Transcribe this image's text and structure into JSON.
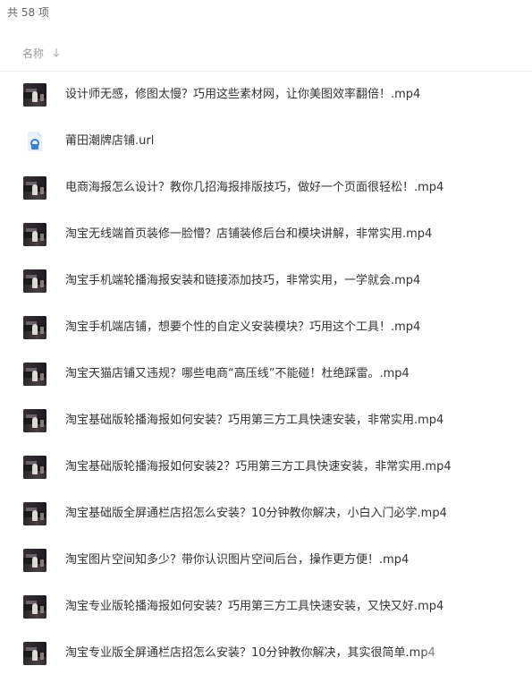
{
  "summary": {
    "count_text": "共 58 项"
  },
  "header": {
    "name_label": "名称"
  },
  "files": [
    {
      "name": "设计师无感，修图太慢？巧用这些素材网，让你美图效率翻倍！.mp4",
      "icon": "video-thumbnail-icon"
    },
    {
      "name": "莆田潮牌店铺.url",
      "icon": "link-file-icon"
    },
    {
      "name": "电商海报怎么设计？教你几招海报排版技巧，做好一个页面很轻松！.mp4",
      "icon": "video-thumbnail-icon"
    },
    {
      "name": "淘宝无线端首页装修一脸懵？店铺装修后台和模块讲解，非常实用.mp4",
      "icon": "video-thumbnail-icon"
    },
    {
      "name": "淘宝手机端轮播海报安装和链接添加技巧，非常实用，一学就会.mp4",
      "icon": "video-thumbnail-icon"
    },
    {
      "name": "淘宝手机端店铺，想要个性的自定义安装模块？巧用这个工具！.mp4",
      "icon": "video-thumbnail-icon"
    },
    {
      "name": "淘宝天猫店铺又违规？哪些电商“高压线”不能碰！杜绝踩雷。.mp4",
      "icon": "video-thumbnail-icon"
    },
    {
      "name": "淘宝基础版轮播海报如何安装？巧用第三方工具快速安装，非常实用.mp4",
      "icon": "video-thumbnail-icon"
    },
    {
      "name": "淘宝基础版轮播海报如何安装2？巧用第三方工具快速安装，非常实用.mp4",
      "icon": "video-thumbnail-icon"
    },
    {
      "name": "淘宝基础版全屏通栏店招怎么安装？10分钟教你解决，小白入门必学.mp4",
      "icon": "video-thumbnail-icon"
    },
    {
      "name": "淘宝图片空间知多少？带你认识图片空间后台，操作更方便！.mp4",
      "icon": "video-thumbnail-icon"
    },
    {
      "name": "淘宝专业版轮播海报如何安装？巧用第三方工具快速安装，又快又好.mp4",
      "icon": "video-thumbnail-icon"
    },
    {
      "name": "淘宝专业版全屏通栏店招怎么安装？10分钟教你解决，其实很简单.mp4",
      "icon": "video-thumbnail-icon"
    }
  ],
  "colors": {
    "text": "#333333",
    "muted": "#999999",
    "url_icon": "#3b7ddd",
    "url_icon_bg": "#e8f0fc"
  }
}
